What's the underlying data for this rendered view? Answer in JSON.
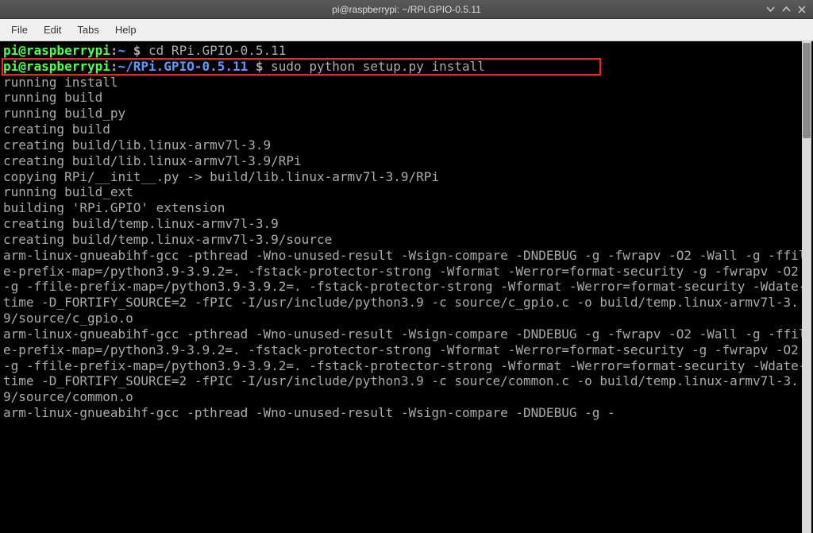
{
  "titlebar": {
    "title": "pi@raspberrypi: ~/RPi.GPIO-0.5.11"
  },
  "menu": {
    "file": "File",
    "edit": "Edit",
    "tabs": "Tabs",
    "help": "Help"
  },
  "line1": {
    "user": "pi@raspberrypi",
    "colon": ":",
    "path": "~ ",
    "dollar": "$ ",
    "cmd": "cd RPi.GPIO-0.5.11"
  },
  "line2": {
    "user": "pi@raspberrypi",
    "colon": ":",
    "path": "~/RPi.GPIO-0.5.11 ",
    "dollar": "$ ",
    "cmd": "sudo python setup.py install"
  },
  "out": {
    "l3": "running install",
    "l4": "running build",
    "l5": "running build_py",
    "l6": "creating build",
    "l7": "creating build/lib.linux-armv7l-3.9",
    "l8": "creating build/lib.linux-armv7l-3.9/RPi",
    "l9": "copying RPi/__init__.py -> build/lib.linux-armv7l-3.9/RPi",
    "l10": "running build_ext",
    "l11": "building 'RPi.GPIO' extension",
    "l12": "creating build/temp.linux-armv7l-3.9",
    "l13": "creating build/temp.linux-armv7l-3.9/source",
    "l14": "arm-linux-gnueabihf-gcc -pthread -Wno-unused-result -Wsign-compare -DNDEBUG -g -fwrapv -O2 -Wall -g -ffile-prefix-map=/python3.9-3.9.2=. -fstack-protector-strong -Wformat -Werror=format-security -g -fwrapv -O2 -g -ffile-prefix-map=/python3.9-3.9.2=. -fstack-protector-strong -Wformat -Werror=format-security -Wdate-time -D_FORTIFY_SOURCE=2 -fPIC -I/usr/include/python3.9 -c source/c_gpio.c -o build/temp.linux-armv7l-3.9/source/c_gpio.o",
    "l15": "arm-linux-gnueabihf-gcc -pthread -Wno-unused-result -Wsign-compare -DNDEBUG -g -fwrapv -O2 -Wall -g -ffile-prefix-map=/python3.9-3.9.2=. -fstack-protector-strong -Wformat -Werror=format-security -g -fwrapv -O2 -g -ffile-prefix-map=/python3.9-3.9.2=. -fstack-protector-strong -Wformat -Werror=format-security -Wdate-time -D_FORTIFY_SOURCE=2 -fPIC -I/usr/include/python3.9 -c source/common.c -o build/temp.linux-armv7l-3.9/source/common.o",
    "l16": "arm-linux-gnueabihf-gcc -pthread -Wno-unused-result -Wsign-compare -DNDEBUG -g -"
  }
}
